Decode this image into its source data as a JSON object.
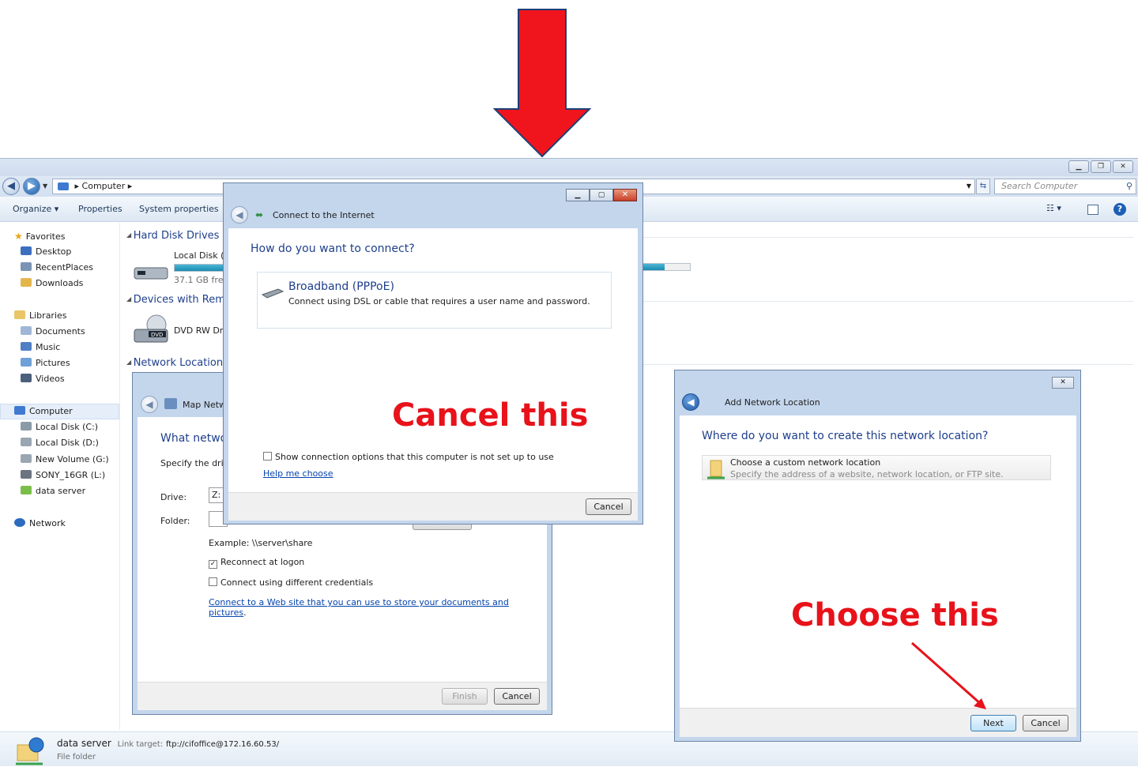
{
  "explorer": {
    "address_crumb": "Computer",
    "address_sep": "▸",
    "search_placeholder": "Search Computer",
    "toolbar": {
      "organize": "Organize ▾",
      "properties": "Properties",
      "system_properties": "System properties"
    },
    "nav": {
      "favorites": "Favorites",
      "desktop": "Desktop",
      "recentplaces": "RecentPlaces",
      "downloads": "Downloads",
      "libraries": "Libraries",
      "documents": "Documents",
      "music": "Music",
      "pictures": "Pictures",
      "videos": "Videos",
      "computer": "Computer",
      "local_c": "Local Disk (C:)",
      "local_d": "Local Disk (D:)",
      "new_volume": "New Volume (G:)",
      "sony": "SONY_16GR (L:)",
      "data_server": "data server",
      "network": "Network"
    },
    "content": {
      "hdd_header": "Hard Disk Drives (",
      "local_disk_label": "Local Disk (C",
      "local_disk_free": "37.1 GB free",
      "devices_header": "Devices with Remo",
      "dvd_label": "DVD RW Dri",
      "network_header": "Network Location"
    },
    "details": {
      "name": "data server",
      "link_target_label": "Link target:",
      "link_target": "ftp://cifoffice@172.16.60.53/",
      "type": "File folder"
    }
  },
  "map_network": {
    "title": "Map Netw",
    "heading": "What netwo",
    "specify": "Specify the drive",
    "drive_label": "Drive:",
    "drive_value": "Z:",
    "folder_label": "Folder:",
    "example": "Example: \\\\server\\share",
    "reconnect": "Reconnect at logon",
    "reconnect_checked": true,
    "different_creds": "Connect using different credentials",
    "web_link": "Connect to a Web site that you can use to store your documents and pictures",
    "finish": "Finish",
    "cancel": "Cancel"
  },
  "connect_internet": {
    "title": "Connect to the Internet",
    "heading": "How do you want to connect?",
    "option_title": "Broadband (PPPoE)",
    "option_desc": "Connect using DSL or cable that requires a user name and password.",
    "show_options": "Show connection options that this computer is not set up to use",
    "help_link": "Help me choose",
    "cancel": "Cancel"
  },
  "add_network": {
    "title": "Add Network Location",
    "heading": "Where do you want to create this network location?",
    "option_title": "Choose a custom network location",
    "option_desc": "Specify the address of a website, network location, or FTP site.",
    "next": "Next",
    "cancel": "Cancel"
  },
  "annotations": {
    "cancel_this": "Cancel this",
    "choose_this": "Choose this"
  },
  "colors": {
    "annotation_red": "#e8121a",
    "link_blue": "#0645ad",
    "heading_blue": "#1e3f8c"
  }
}
